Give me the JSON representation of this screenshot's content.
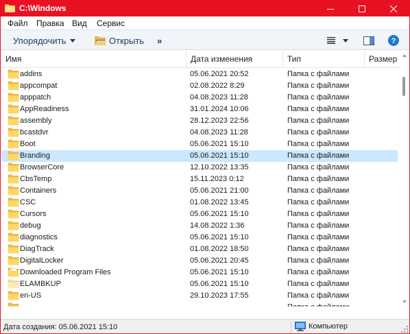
{
  "window": {
    "title": "C:\\Windows",
    "accent": "#e81123"
  },
  "menu": {
    "items": [
      {
        "label": "Файл"
      },
      {
        "label": "Правка"
      },
      {
        "label": "Вид"
      },
      {
        "label": "Сервис"
      }
    ]
  },
  "toolbar": {
    "organize_label": "Упорядочить",
    "open_label": "Открыть",
    "more_label": "»"
  },
  "columns": {
    "name": "Имя",
    "date": "Дата изменения",
    "type": "Тип",
    "size": "Размер"
  },
  "files": [
    {
      "name": "addins",
      "date": "05.06.2021 20:52",
      "type": "Папка с файлами",
      "icon": "folder-icon"
    },
    {
      "name": "appcompat",
      "date": "02.08.2022 8:29",
      "type": "Папка с файлами",
      "icon": "folder-icon"
    },
    {
      "name": "apppatch",
      "date": "04.08.2023 11:28",
      "type": "Папка с файлами",
      "icon": "folder-icon"
    },
    {
      "name": "AppReadiness",
      "date": "31.01.2024 10:06",
      "type": "Папка с файлами",
      "icon": "folder-icon"
    },
    {
      "name": "assembly",
      "date": "28.12.2023 22:56",
      "type": "Папка с файлами",
      "icon": "folder-icon"
    },
    {
      "name": "bcastdvr",
      "date": "04.08.2023 11:28",
      "type": "Папка с файлами",
      "icon": "folder-icon"
    },
    {
      "name": "Boot",
      "date": "05.06.2021 15:10",
      "type": "Папка с файлами",
      "icon": "folder-icon"
    },
    {
      "name": "Branding",
      "date": "05.06.2021 15:10",
      "type": "Папка с файлами",
      "icon": "folder-icon",
      "selected": true
    },
    {
      "name": "BrowserCore",
      "date": "12.10.2022 13:35",
      "type": "Папка с файлами",
      "icon": "folder-icon"
    },
    {
      "name": "CbsTemp",
      "date": "15.11.2023 0:12",
      "type": "Папка с файлами",
      "icon": "folder-icon"
    },
    {
      "name": "Containers",
      "date": "05.06.2021 21:00",
      "type": "Папка с файлами",
      "icon": "folder-icon"
    },
    {
      "name": "CSC",
      "date": "01.08.2022 13:45",
      "type": "Папка с файлами",
      "icon": "folder-icon"
    },
    {
      "name": "Cursors",
      "date": "05.06.2021 15:10",
      "type": "Папка с файлами",
      "icon": "folder-icon"
    },
    {
      "name": "debug",
      "date": "14.08.2022 1:36",
      "type": "Папка с файлами",
      "icon": "folder-icon"
    },
    {
      "name": "diagnostics",
      "date": "05.06.2021 15:10",
      "type": "Папка с файлами",
      "icon": "folder-icon"
    },
    {
      "name": "DiagTrack",
      "date": "01.08.2022 18:50",
      "type": "Папка с файлами",
      "icon": "folder-icon"
    },
    {
      "name": "DigitalLocker",
      "date": "05.06.2021 20:45",
      "type": "Папка с файлами",
      "icon": "folder-icon"
    },
    {
      "name": "Downloaded Program Files",
      "date": "05.06.2021 15:10",
      "type": "Папка с файлами",
      "icon": "folder-doc-icon"
    },
    {
      "name": "ELAMBKUP",
      "date": "05.06.2021 15:10",
      "type": "Папка с файлами",
      "icon": "folder-light-icon"
    },
    {
      "name": "en-US",
      "date": "29.10.2023 17:55",
      "type": "Папка с файлами",
      "icon": "folder-icon"
    },
    {
      "name": "",
      "date": "",
      "type": "Папка с файлами",
      "icon": "folder-icon"
    }
  ],
  "status": {
    "text": "Дата создания: 05.06.2021 15:10",
    "computer_label": "Компьютер"
  }
}
